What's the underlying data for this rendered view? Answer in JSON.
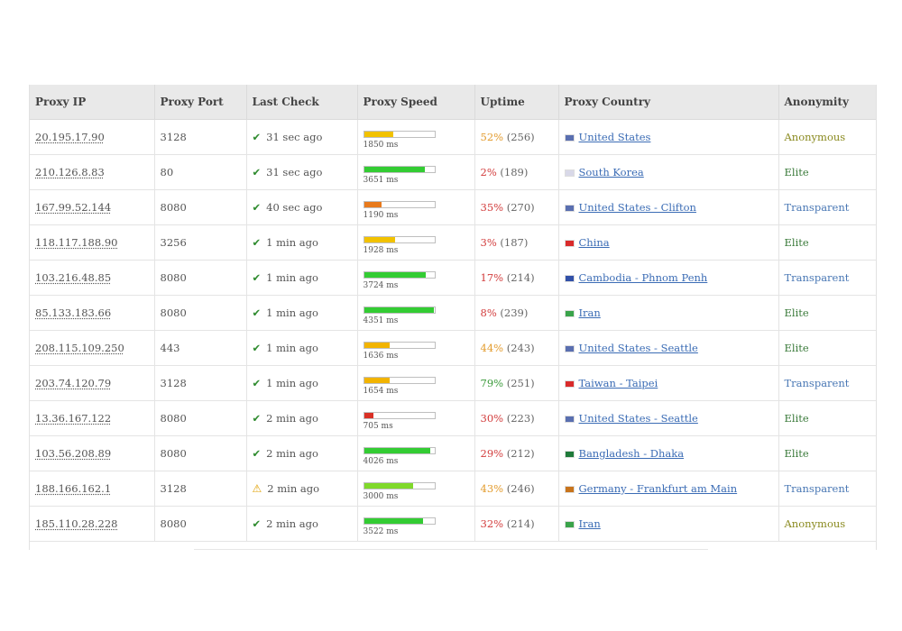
{
  "columns": [
    "Proxy IP",
    "Proxy Port",
    "Last Check",
    "Proxy Speed",
    "Uptime",
    "Proxy Country",
    "Anonymity"
  ],
  "colors": {
    "ok_green": "#2e8b2e",
    "link_blue": "#3b6cb5",
    "elite": "#3a7a3a",
    "anonymous": "#8a8a1f",
    "transparent": "#4a78b5"
  },
  "rows": [
    {
      "ip": "20.195.17.90",
      "port": "3128",
      "status_icon": "check-icon",
      "last_check": "31 sec ago",
      "speed_label": "1850 ms",
      "speed_fill": 0.42,
      "speed_color": "#f2c200",
      "uptime_pct": "52%",
      "uptime_count": "(256)",
      "uptime_color": "#e39b2c",
      "flag_icon": "flag-us-icon",
      "flag_color": "#5a6fb0",
      "country": "United States",
      "anonymity": "Anonymous",
      "anonymity_color": "#8a8a1f"
    },
    {
      "ip": "210.126.8.83",
      "port": "80",
      "status_icon": "check-icon",
      "last_check": "31 sec ago",
      "speed_label": "3651 ms",
      "speed_fill": 0.86,
      "speed_color": "#33cc33",
      "uptime_pct": "2%",
      "uptime_count": "(189)",
      "uptime_color": "#d23c3c",
      "flag_icon": "flag-kr-icon",
      "flag_color": "#d8d8e8",
      "country": "South Korea",
      "anonymity": "Elite",
      "anonymity_color": "#3a7a3a"
    },
    {
      "ip": "167.99.52.144",
      "port": "8080",
      "status_icon": "check-icon",
      "last_check": "40 sec ago",
      "speed_label": "1190 ms",
      "speed_fill": 0.25,
      "speed_color": "#e87a1c",
      "uptime_pct": "35%",
      "uptime_count": "(270)",
      "uptime_color": "#d23c3c",
      "flag_icon": "flag-us-icon",
      "flag_color": "#5a6fb0",
      "country": "United States - Clifton",
      "anonymity": "Transparent",
      "anonymity_color": "#4a78b5"
    },
    {
      "ip": "118.117.188.90",
      "port": "3256",
      "status_icon": "check-icon",
      "last_check": "1 min ago",
      "speed_label": "1928 ms",
      "speed_fill": 0.44,
      "speed_color": "#f2c200",
      "uptime_pct": "3%",
      "uptime_count": "(187)",
      "uptime_color": "#d23c3c",
      "flag_icon": "flag-cn-icon",
      "flag_color": "#d92b2b",
      "country": "China",
      "anonymity": "Elite",
      "anonymity_color": "#3a7a3a"
    },
    {
      "ip": "103.216.48.85",
      "port": "8080",
      "status_icon": "check-icon",
      "last_check": "1 min ago",
      "speed_label": "3724 ms",
      "speed_fill": 0.88,
      "speed_color": "#33cc33",
      "uptime_pct": "17%",
      "uptime_count": "(214)",
      "uptime_color": "#d23c3c",
      "flag_icon": "flag-kh-icon",
      "flag_color": "#3251a8",
      "country": "Cambodia - Phnom Penh",
      "anonymity": "Transparent",
      "anonymity_color": "#4a78b5"
    },
    {
      "ip": "85.133.183.66",
      "port": "8080",
      "status_icon": "check-icon",
      "last_check": "1 min ago",
      "speed_label": "4351 ms",
      "speed_fill": 0.99,
      "speed_color": "#33cc33",
      "uptime_pct": "8%",
      "uptime_count": "(239)",
      "uptime_color": "#d23c3c",
      "flag_icon": "flag-ir-icon",
      "flag_color": "#3aa34a",
      "country": "Iran",
      "anonymity": "Elite",
      "anonymity_color": "#3a7a3a"
    },
    {
      "ip": "208.115.109.250",
      "port": "443",
      "status_icon": "check-icon",
      "last_check": "1 min ago",
      "speed_label": "1636 ms",
      "speed_fill": 0.37,
      "speed_color": "#f2b400",
      "uptime_pct": "44%",
      "uptime_count": "(243)",
      "uptime_color": "#e39b2c",
      "flag_icon": "flag-us-icon",
      "flag_color": "#5a6fb0",
      "country": "United States - Seattle",
      "anonymity": "Elite",
      "anonymity_color": "#3a7a3a"
    },
    {
      "ip": "203.74.120.79",
      "port": "3128",
      "status_icon": "check-icon",
      "last_check": "1 min ago",
      "speed_label": "1654 ms",
      "speed_fill": 0.37,
      "speed_color": "#f2b400",
      "uptime_pct": "79%",
      "uptime_count": "(251)",
      "uptime_color": "#3a9a3a",
      "flag_icon": "flag-tw-icon",
      "flag_color": "#d92b2b",
      "country": "Taiwan - Taipei",
      "anonymity": "Transparent",
      "anonymity_color": "#4a78b5"
    },
    {
      "ip": "13.36.167.122",
      "port": "8080",
      "status_icon": "check-icon",
      "last_check": "2 min ago",
      "speed_label": "705 ms",
      "speed_fill": 0.13,
      "speed_color": "#d93025",
      "uptime_pct": "30%",
      "uptime_count": "(223)",
      "uptime_color": "#d23c3c",
      "flag_icon": "flag-us-icon",
      "flag_color": "#5a6fb0",
      "country": "United States - Seattle",
      "anonymity": "Elite",
      "anonymity_color": "#3a7a3a"
    },
    {
      "ip": "103.56.208.89",
      "port": "8080",
      "status_icon": "check-icon",
      "last_check": "2 min ago",
      "speed_label": "4026 ms",
      "speed_fill": 0.94,
      "speed_color": "#33cc33",
      "uptime_pct": "29%",
      "uptime_count": "(212)",
      "uptime_color": "#d23c3c",
      "flag_icon": "flag-bd-icon",
      "flag_color": "#1f7a3a",
      "country": "Bangladesh - Dhaka",
      "anonymity": "Elite",
      "anonymity_color": "#3a7a3a"
    },
    {
      "ip": "188.166.162.1",
      "port": "3128",
      "status_icon": "warning-icon",
      "last_check": "2 min ago",
      "speed_label": "3000 ms",
      "speed_fill": 0.7,
      "speed_color": "#7fd92a",
      "uptime_pct": "43%",
      "uptime_count": "(246)",
      "uptime_color": "#e39b2c",
      "flag_icon": "flag-de-icon",
      "flag_color": "#c8741c",
      "country": "Germany - Frankfurt am Main",
      "anonymity": "Transparent",
      "anonymity_color": "#4a78b5"
    },
    {
      "ip": "185.110.28.228",
      "port": "8080",
      "status_icon": "check-icon",
      "last_check": "2 min ago",
      "speed_label": "3522 ms",
      "speed_fill": 0.84,
      "speed_color": "#33cc33",
      "uptime_pct": "32%",
      "uptime_count": "(214)",
      "uptime_color": "#d23c3c",
      "flag_icon": "flag-ir-icon",
      "flag_color": "#3aa34a",
      "country": "Iran",
      "anonymity": "Anonymous",
      "anonymity_color": "#8a8a1f"
    }
  ]
}
